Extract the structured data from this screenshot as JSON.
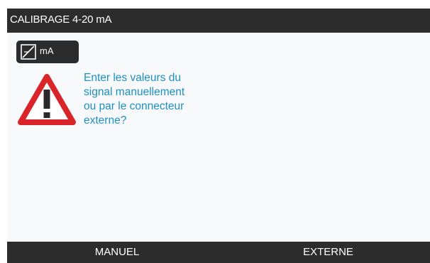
{
  "header": {
    "title": "CALIBRAGE 4-20 mA"
  },
  "unit_chip": {
    "label": "mA",
    "icon": "calibration-slope-icon"
  },
  "dialog": {
    "icon": "warning-triangle-icon",
    "message_lines": [
      "Enter les valeurs du",
      "signal manuellement",
      "ou par le connecteur",
      "externe?"
    ]
  },
  "softkeys": {
    "left_label": "MANUEL",
    "right_label": "EXTERNE"
  },
  "colors": {
    "bar_background": "#2c2c2c",
    "screen_background": "#f7f9fb",
    "message_text": "#1f8fc0",
    "warning_red": "#d9252a"
  }
}
